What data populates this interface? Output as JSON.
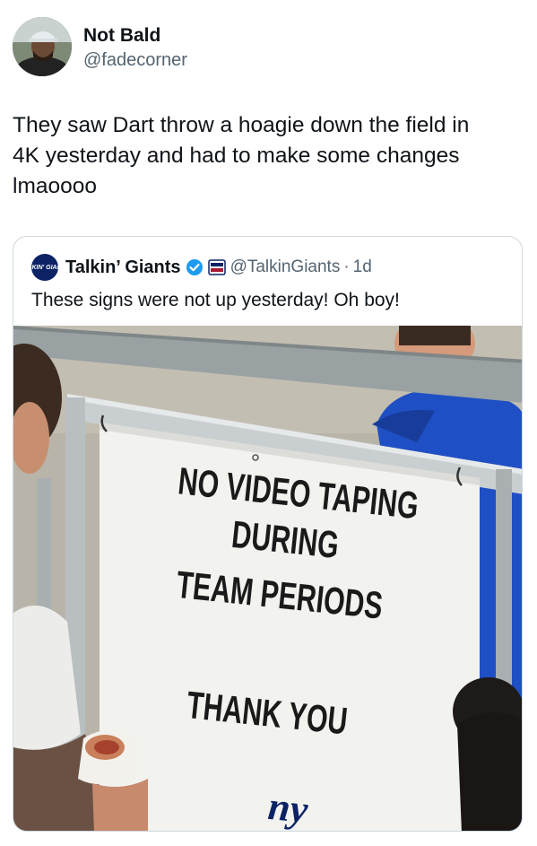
{
  "author": {
    "name": "Not Bald",
    "handle": "@fadecorner"
  },
  "tweet": {
    "line1": "They saw Dart throw a hoagie down the field in",
    "line2": "4K yesterday and had to make some changes",
    "line3": "lmaoooo"
  },
  "quoted": {
    "avatar_text": "TALKIN' GIANTS",
    "name": "Talkin’ Giants",
    "verified_icon": "verified-badge-icon",
    "affiliate_icon": "affiliate-badge-icon",
    "handle": "@TalkinGiants",
    "separator": "·",
    "time": "1d",
    "text": "These signs were not up yesterday! Oh boy!"
  },
  "sign": {
    "line1": "NO VIDEO TAPING",
    "line2": "DURING",
    "line3": "TEAM PERIODS",
    "line4": "THANK YOU",
    "logo": "ny"
  },
  "colors": {
    "verified": "#1d9bf0",
    "giants_blue": "#0b2265",
    "giants_red": "#a71930",
    "muted": "#536471"
  }
}
